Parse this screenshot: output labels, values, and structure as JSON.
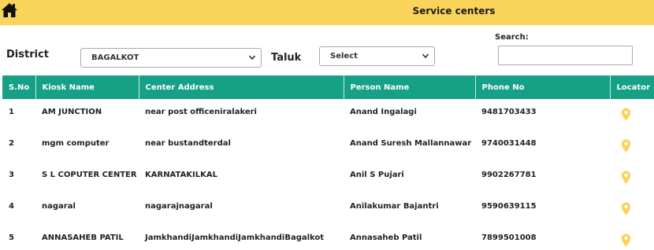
{
  "header": {
    "title": "Service centers",
    "home_icon": "home-icon",
    "background_color": "#f9d35a"
  },
  "filters": {
    "district_label": "District",
    "district_value": "BAGALKOT",
    "taluk_label": "Taluk",
    "taluk_value": "Select",
    "search_label": "Search:",
    "search_value": ""
  },
  "table": {
    "header_color": "#16a085",
    "columns": [
      "S.No",
      "Kiosk Name",
      "Center Address",
      "Person Name",
      "Phone No",
      "Locator"
    ],
    "rows": [
      {
        "sno": "1",
        "kiosk": "AM JUNCTION",
        "address": "near post officeniralakeri",
        "person": "Anand Ingalagi",
        "phone": "9481703433",
        "locator": "location-pin-icon"
      },
      {
        "sno": "2",
        "kiosk": "mgm computer",
        "address": "near bustandterdal",
        "person": "Anand Suresh Mallannawar",
        "phone": "9740031448",
        "locator": "location-pin-icon"
      },
      {
        "sno": "3",
        "kiosk": "S L COPUTER CENTER",
        "address": "KARNATAKILKAL",
        "person": "Anil S Pujari",
        "phone": "9902267781",
        "locator": "location-pin-icon"
      },
      {
        "sno": "4",
        "kiosk": "nagaral",
        "address": "nagarajnagaral",
        "person": "Anilakumar Bajantri",
        "phone": "9590639115",
        "locator": "location-pin-icon"
      },
      {
        "sno": "5",
        "kiosk": "ANNASAHEB PATIL",
        "address": "JamkhandiJamkhandiJamkhandiBagalkot",
        "person": "Annasaheb Patil",
        "phone": "7899501008",
        "locator": "location-pin-icon"
      }
    ]
  }
}
